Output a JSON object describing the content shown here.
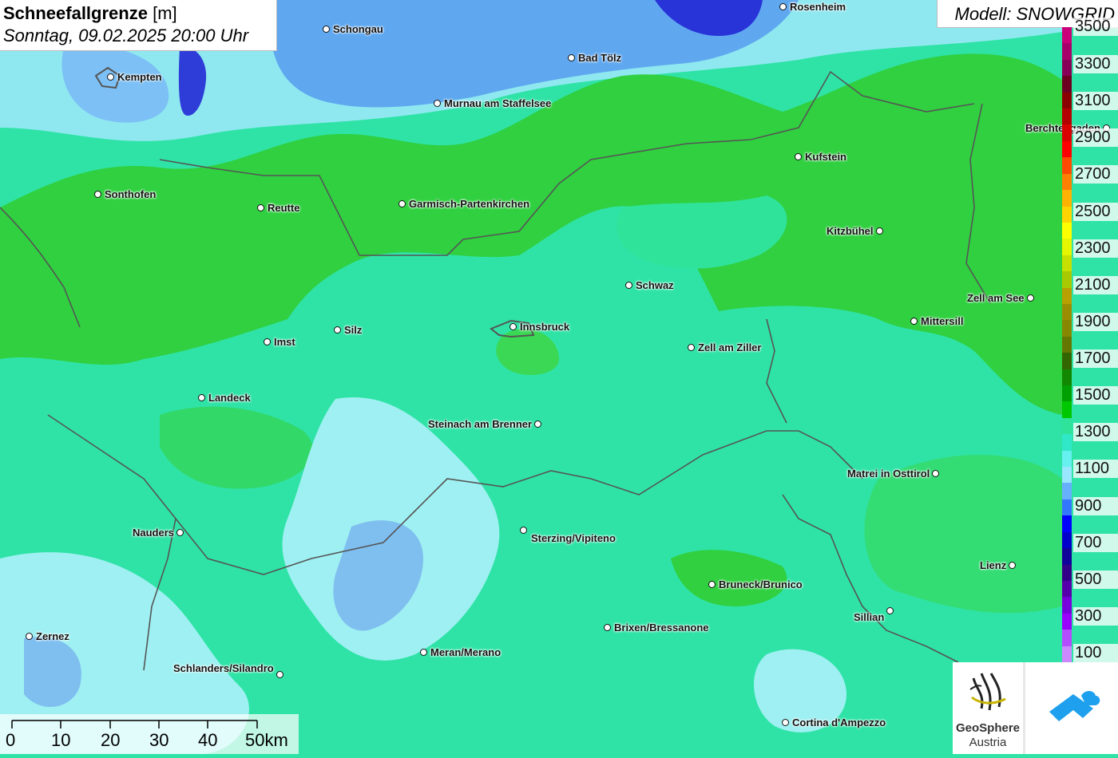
{
  "title": {
    "main": "Schneefallgrenze",
    "unit": "[m]",
    "datetime": "Sonntag, 09.02.2025 20:00 Uhr"
  },
  "model": "Modell: SNOWGRID",
  "legend": {
    "labels": [
      "3500",
      "3300",
      "3100",
      "2900",
      "2700",
      "2500",
      "2300",
      "2100",
      "1900",
      "1700",
      "1500",
      "1300",
      "1100",
      "900",
      "700",
      "500",
      "300",
      "100"
    ],
    "colors": [
      "#c9007a",
      "#a8006b",
      "#870058",
      "#6b0021",
      "#8a0000",
      "#b30000",
      "#d90000",
      "#ff0000",
      "#ff4a00",
      "#ff7f00",
      "#ffb300",
      "#ffd400",
      "#ffff00",
      "#e6f500",
      "#c8e000",
      "#a8c800",
      "#b8a000",
      "#9c8c00",
      "#888800",
      "#667700",
      "#336600",
      "#118800",
      "#00a000",
      "#00c800",
      "#2fe39a",
      "#30e8c8",
      "#66f0f0",
      "#99e6ff",
      "#66b0ff",
      "#3377ff",
      "#0000ff",
      "#0000cc",
      "#110099",
      "#330088",
      "#5500aa",
      "#7700dd",
      "#9900ff",
      "#b44dff",
      "#cc88ff"
    ]
  },
  "cities": [
    {
      "name": "Schongau"
    },
    {
      "name": "Rosenheim"
    },
    {
      "name": "Bad Tölz"
    },
    {
      "name": "Kempten"
    },
    {
      "name": "Murnau am Staffelsee"
    },
    {
      "name": "Berchtesgaden"
    },
    {
      "name": "Kufstein"
    },
    {
      "name": "Sonthofen"
    },
    {
      "name": "Reutte"
    },
    {
      "name": "Garmisch-Partenkirchen"
    },
    {
      "name": "Kitzbühel"
    },
    {
      "name": "Schwaz"
    },
    {
      "name": "Zell am See"
    },
    {
      "name": "Mittersill"
    },
    {
      "name": "Silz"
    },
    {
      "name": "Innsbruck"
    },
    {
      "name": "Imst"
    },
    {
      "name": "Zell am Ziller"
    },
    {
      "name": "Landeck"
    },
    {
      "name": "Steinach am Brenner"
    },
    {
      "name": "Matrei in Osttirol"
    },
    {
      "name": "Nauders"
    },
    {
      "name": "Sterzing/Vipiteno"
    },
    {
      "name": "Lienz"
    },
    {
      "name": "Bruneck/Brunico"
    },
    {
      "name": "Sillian"
    },
    {
      "name": "Brixen/Bressanone"
    },
    {
      "name": "Zernez"
    },
    {
      "name": "Meran/Merano"
    },
    {
      "name": "Schlanders/Silandro"
    },
    {
      "name": "Cortina d'Ampezzo"
    }
  ],
  "scale": {
    "ticks": [
      "0",
      "10",
      "20",
      "30",
      "40",
      "50km"
    ]
  },
  "logos": {
    "geosphere_line1": "GeoSphere",
    "geosphere_line2": "Austria"
  }
}
